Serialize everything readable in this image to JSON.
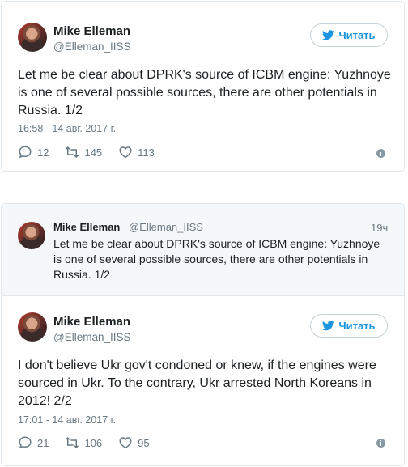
{
  "tweet1": {
    "name": "Mike Elleman",
    "handle": "@Elleman_IISS",
    "follow_label": "Читать",
    "text": "Let me be clear about DPRK's source of ICBM engine: Yuzhnoye is one of several possible sources, there are other potentials in Russia. 1/2",
    "timestamp": "16:58 - 14 авг. 2017 г.",
    "replies": "12",
    "retweets": "145",
    "likes": "113"
  },
  "tweet2": {
    "quoted": {
      "name": "Mike Elleman",
      "handle": "@Elleman_IISS",
      "time_ago": "19ч",
      "text": "Let me be clear about DPRK's source of ICBM engine: Yuzhnoye is one of several possible sources, there are other potentials in Russia. 1/2"
    },
    "name": "Mike Elleman",
    "handle": "@Elleman_IISS",
    "follow_label": "Читать",
    "text": "I don't believe Ukr gov't condoned or knew, if the engines were sourced in Ukr. To the contrary, Ukr arrested North Koreans in 2012! 2/2",
    "timestamp": "17:01 - 14 авг. 2017 г.",
    "replies": "21",
    "retweets": "106",
    "likes": "95"
  },
  "colors": {
    "accent": "#1b95e0",
    "secondary_text": "#697882",
    "border": "#e1e8ed",
    "quote_bg": "#f5f8fa"
  },
  "icons": [
    "bird-icon",
    "reply-icon",
    "retweet-icon",
    "heart-icon",
    "info-icon"
  ]
}
